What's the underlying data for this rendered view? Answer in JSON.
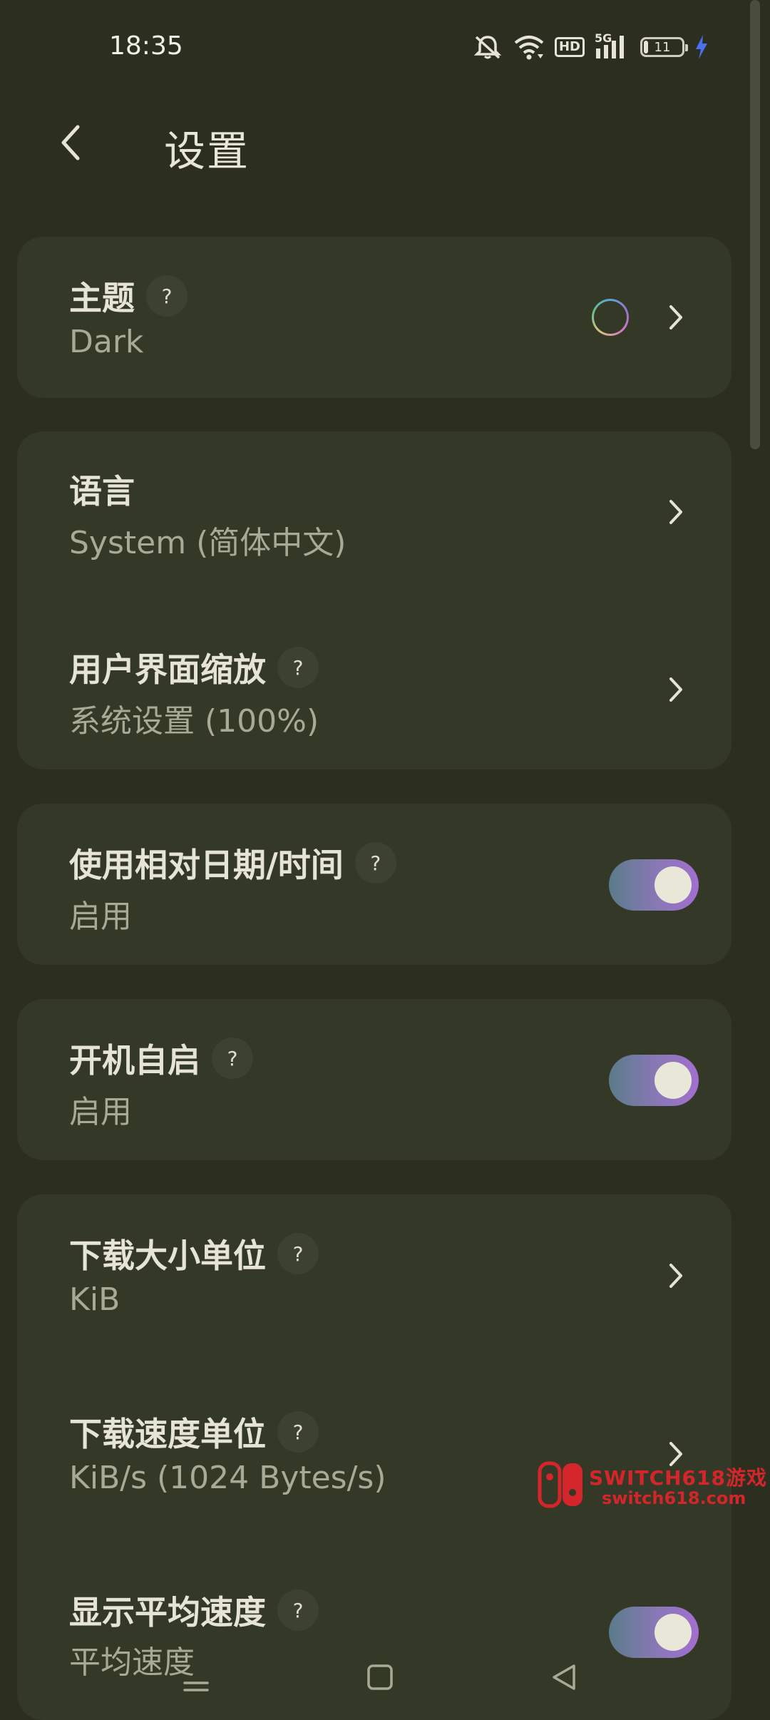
{
  "status_bar": {
    "time": "18:35",
    "hd": "HD",
    "network": "5G",
    "battery_level": "11",
    "icons": [
      "mute-bell-icon",
      "wifi-icon",
      "hd-icon",
      "signal-5g-icon",
      "battery-icon",
      "charging-icon"
    ]
  },
  "header": {
    "title": "设置",
    "back_icon": "chevron-left-icon"
  },
  "settings": {
    "theme": {
      "title": "主题",
      "value": "Dark",
      "help": "?"
    },
    "language": {
      "title": "语言",
      "value": "System (简体中文)"
    },
    "ui_scale": {
      "title": "用户界面缩放",
      "value": "系统设置 (100%)",
      "help": "?"
    },
    "relative_date": {
      "title": "使用相对日期/时间",
      "value": "启用",
      "help": "?",
      "enabled": true
    },
    "autostart": {
      "title": "开机自启",
      "value": "启用",
      "help": "?",
      "enabled": true
    },
    "size_unit": {
      "title": "下载大小单位",
      "value": "KiB",
      "help": "?"
    },
    "speed_unit": {
      "title": "下载速度单位",
      "value": "KiB/s (1024 Bytes/s)",
      "help": "?"
    },
    "avg_speed": {
      "title": "显示平均速度",
      "value": "平均速度",
      "help": "?",
      "enabled": true
    }
  },
  "watermark": {
    "line1": "SWITCH618游戏",
    "line2": "switch618.com"
  },
  "nav_bar": {
    "icons": [
      "menu-icon",
      "home-square-icon",
      "back-triangle-icon"
    ]
  },
  "colors": {
    "background": "#2c2f20",
    "card": "#343826",
    "text_primary": "#e6e4d6",
    "text_secondary": "#a9aa96",
    "toggle_gradient_start": "#5b7b8a",
    "toggle_gradient_end": "#a16fcf",
    "watermark_red": "#d4262a"
  }
}
